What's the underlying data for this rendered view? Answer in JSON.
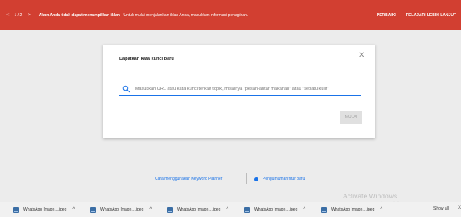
{
  "alert": {
    "nav_prev": "<",
    "page_count": "1 / 2",
    "nav_next": ">",
    "message_bold": "Akun Anda tidak dapat menampilkan iklan",
    "message_rest": " - Untuk mulai menjalankan iklan Anda, masukkan informasi penagihan.",
    "action_fix": "PERBAIKI",
    "action_learn": "PELAJARI LEBIH LANJUT",
    "color": "#d23f31"
  },
  "dialog": {
    "title": "Dapatkan kata kunci baru",
    "close_icon": "✕",
    "search_placeholder": "Masukkan URL atau kata kunci terkait topik, misalnya \"pesan-antar makanan\" atau \"sepatu kulit\"",
    "start_label": "MULAI",
    "accent": "#1a73e8"
  },
  "links": {
    "planner": "Cara menggunakan Keyword Planner",
    "announcement": "Pengumuman fitur baru"
  },
  "watermark": {
    "title": "Activate Windows",
    "subtitle": "Go to PC settings to activate Windows."
  },
  "downloads": {
    "items": [
      {
        "name": "WhatsApp Image....jpeg",
        "chevron": "^"
      },
      {
        "name": "WhatsApp Image....jpeg",
        "chevron": "^"
      },
      {
        "name": "WhatsApp Image....jpeg",
        "chevron": "^"
      },
      {
        "name": "WhatsApp Image....jpeg",
        "chevron": "^"
      },
      {
        "name": "WhatsApp Image....jpeg",
        "chevron": "^"
      }
    ],
    "show_all": "Show all",
    "close": "X"
  }
}
